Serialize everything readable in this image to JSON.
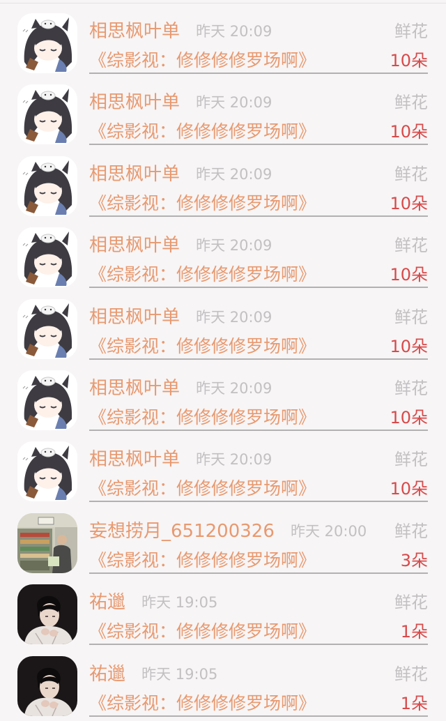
{
  "gift_records": [
    {
      "name": "相思枫叶单",
      "time": "昨天 20:09",
      "book": "《综影视：修修修修罗场啊》",
      "gift": "鲜花",
      "count": "10朵",
      "avatar": "anime-avatar-icon"
    },
    {
      "name": "相思枫叶单",
      "time": "昨天 20:09",
      "book": "《综影视：修修修修罗场啊》",
      "gift": "鲜花",
      "count": "10朵",
      "avatar": "anime-avatar-icon"
    },
    {
      "name": "相思枫叶单",
      "time": "昨天 20:09",
      "book": "《综影视：修修修修罗场啊》",
      "gift": "鲜花",
      "count": "10朵",
      "avatar": "anime-avatar-icon"
    },
    {
      "name": "相思枫叶单",
      "time": "昨天 20:09",
      "book": "《综影视：修修修修罗场啊》",
      "gift": "鲜花",
      "count": "10朵",
      "avatar": "anime-avatar-icon"
    },
    {
      "name": "相思枫叶单",
      "time": "昨天 20:09",
      "book": "《综影视：修修修修罗场啊》",
      "gift": "鲜花",
      "count": "10朵",
      "avatar": "anime-avatar-icon"
    },
    {
      "name": "相思枫叶单",
      "time": "昨天 20:09",
      "book": "《综影视：修修修修罗场啊》",
      "gift": "鲜花",
      "count": "10朵",
      "avatar": "anime-avatar-icon"
    },
    {
      "name": "相思枫叶单",
      "time": "昨天 20:09",
      "book": "《综影视：修修修修罗场啊》",
      "gift": "鲜花",
      "count": "10朵",
      "avatar": "anime-avatar-icon"
    },
    {
      "name": "妄想捞月_651200326",
      "time": "昨天 20:00",
      "book": "《综影视：修修修修罗场啊》",
      "gift": "鲜花",
      "count": "3朵",
      "avatar": "photo-avatar-icon"
    },
    {
      "name": "祐邋",
      "time": "昨天 19:05",
      "book": "《综影视：修修修修罗场啊》",
      "gift": "鲜花",
      "count": "1朵",
      "avatar": "portrait-avatar-icon"
    },
    {
      "name": "祐邋",
      "time": "昨天 19:05",
      "book": "《综影视：修修修修罗场啊》",
      "gift": "鲜花",
      "count": "1朵",
      "avatar": "portrait-avatar-icon"
    }
  ],
  "colors": {
    "name": "#e8996f",
    "muted": "#c3c0c2",
    "count": "#d84a4a",
    "divider": "#b3b0b2",
    "background": "#f7f5f6"
  }
}
